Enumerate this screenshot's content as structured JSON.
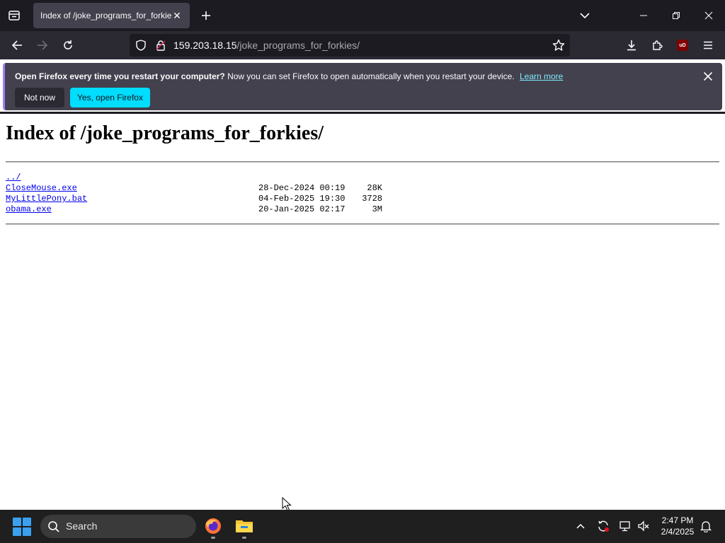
{
  "browser": {
    "tab": {
      "title": "Index of /joke_programs_for_forkies/"
    },
    "url": {
      "host": "159.203.18.15",
      "path": "/joke_programs_for_forkies/"
    }
  },
  "notification": {
    "bold_text": "Open Firefox every time you restart your computer?",
    "text": "Now you can set Firefox to open automatically when you restart your device.",
    "link": "Learn more",
    "not_now": "Not now",
    "yes": "Yes, open Firefox"
  },
  "page": {
    "title": "Index of /joke_programs_for_forkies/",
    "parent_link": "../",
    "entries": [
      {
        "name": "CloseMouse.exe",
        "date": "28-Dec-2024 00:19",
        "size": "28K"
      },
      {
        "name": "MyLittlePony.bat",
        "date": "04-Feb-2025 19:30",
        "size": "3728"
      },
      {
        "name": "obama.exe",
        "date": "20-Jan-2025 02:17",
        "size": "3M"
      }
    ]
  },
  "taskbar": {
    "search_label": "Search",
    "time": "2:47 PM",
    "date": "2/4/2025"
  },
  "icons": {
    "ublock": "uD"
  },
  "colors": {
    "tab_strip": "#1c1b22",
    "toolbar": "#2b2a33",
    "notification": "#42414d",
    "primary_button": "#00ddff",
    "link": "#0000ee",
    "taskbar": "#1f1f1f"
  }
}
